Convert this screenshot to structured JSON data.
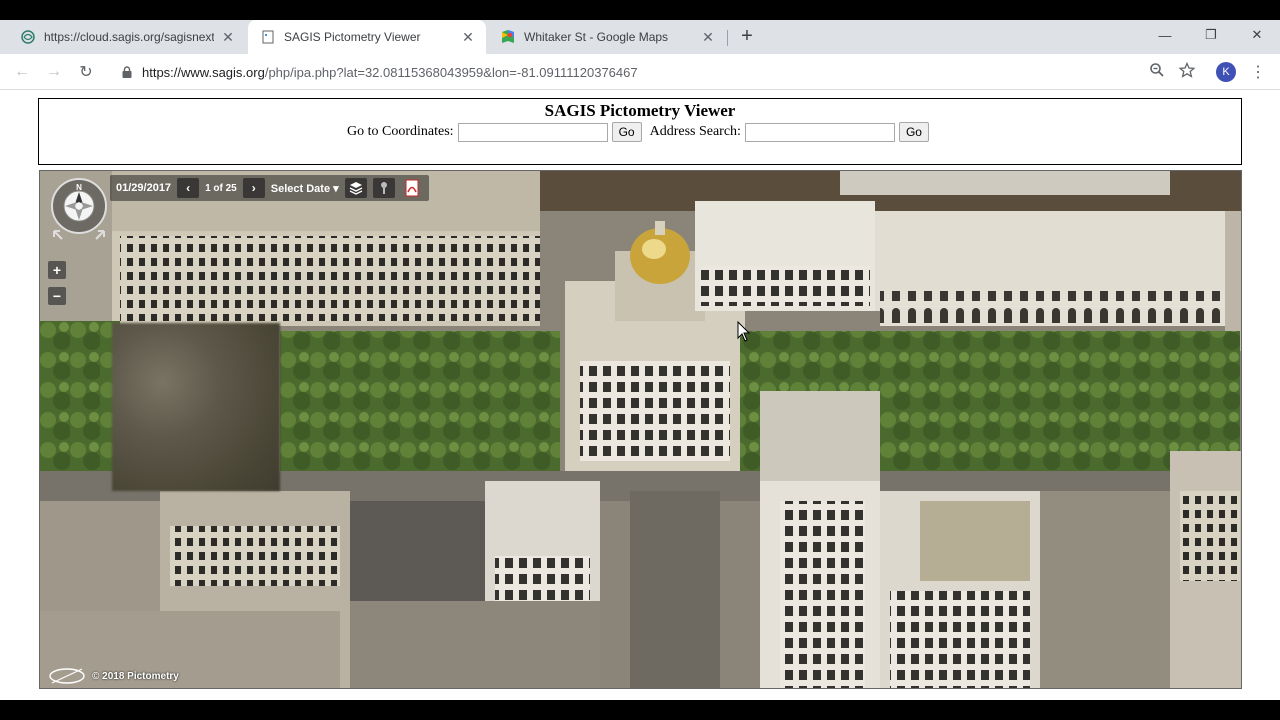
{
  "browser": {
    "tabs": [
      {
        "label": "https://cloud.sagis.org/sagisnext/...",
        "active": false
      },
      {
        "label": "SAGIS Pictometry Viewer",
        "active": true
      },
      {
        "label": "Whitaker St - Google Maps",
        "active": false
      }
    ],
    "new_tab_symbol": "+",
    "window_controls": {
      "minimize": "—",
      "restore": "❐",
      "close": "✕"
    },
    "url_host": "https://www.sagis.org",
    "url_path": "/php/ipa.php?lat=32.08115368043959&lon=-81.09111120376467",
    "profile_initial": "K"
  },
  "page": {
    "title": "SAGIS Pictometry Viewer",
    "coords_label": "Go to Coordinates:",
    "coords_value": "",
    "go_label": "Go",
    "address_label": "Address Search:",
    "address_value": "",
    "go2_label": "Go"
  },
  "viewer": {
    "date": "01/29/2017",
    "image_count": "1 of 25",
    "select_date_label": "Select Date ▾",
    "compass_direction": "N",
    "zoom_in": "+",
    "zoom_out": "−",
    "copyright": "© 2018 Pictometry",
    "icons": [
      "layers-icon",
      "pin-icon",
      "pdf-icon"
    ]
  }
}
